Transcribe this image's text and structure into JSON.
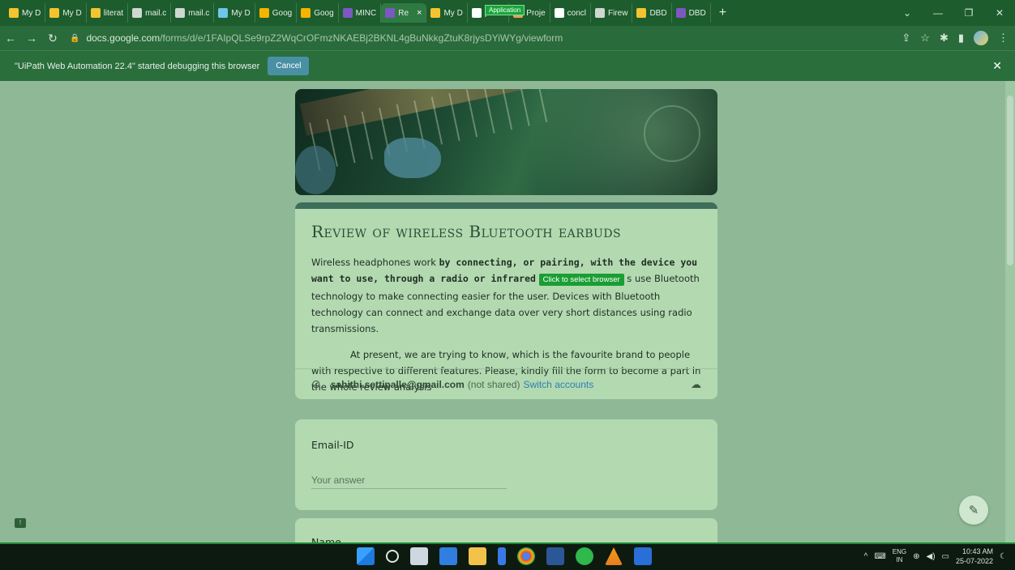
{
  "browser": {
    "tabs": [
      {
        "label": "My D",
        "icon": "drive-icon",
        "color": "#f4c430"
      },
      {
        "label": "My D",
        "icon": "drive-icon",
        "color": "#f4c430"
      },
      {
        "label": "literat",
        "icon": "drive-icon",
        "color": "#f4c430"
      },
      {
        "label": "mail.c",
        "icon": "globe-icon",
        "color": "#cfd8cf"
      },
      {
        "label": "mail.c",
        "icon": "globe-icon",
        "color": "#cfd8cf"
      },
      {
        "label": "My D",
        "icon": "loading-icon",
        "color": "#6ec6e8"
      },
      {
        "label": "Goog",
        "icon": "slides-icon",
        "color": "#f4b400"
      },
      {
        "label": "Goog",
        "icon": "slides-icon",
        "color": "#f4b400"
      },
      {
        "label": "MINC",
        "icon": "forms-icon",
        "color": "#7e57c2"
      },
      {
        "label": "Re",
        "icon": "forms-icon",
        "color": "#7e57c2",
        "active": true
      },
      {
        "label": "My D",
        "icon": "drive-icon",
        "color": "#f4c430"
      },
      {
        "label": "plann",
        "icon": "google-icon",
        "color": "#ffffff"
      },
      {
        "label": "Proje",
        "icon": "ring-icon",
        "color": "#e8a25a"
      },
      {
        "label": "concl",
        "icon": "google-icon",
        "color": "#ffffff"
      },
      {
        "label": "Firew",
        "icon": "globe-icon",
        "color": "#cfd8cf"
      },
      {
        "label": "DBD",
        "icon": "drive-icon",
        "color": "#f4c430"
      },
      {
        "label": "DBD",
        "icon": "forms-icon",
        "color": "#7e57c2"
      }
    ],
    "application_badge": "Application",
    "url_host": "docs.google.com",
    "url_path": "/forms/d/e/1FAIpQLSe9rpZ2WqCrOFmzNKAEBj2BKNL4gBuNkkgZtuK8rjysDYiWYg/viewform",
    "infobar_text": "\"UiPath Web Automation 22.4\" started debugging this browser",
    "infobar_cancel": "Cancel"
  },
  "form": {
    "title": "Review of wireless Bluetooth earbuds",
    "desc_part1": "Wireless headphones work ",
    "desc_bold": "by connecting, or pairing, with the device you want to use, through a radio or infrared",
    "tooltip": "Click to select browser",
    "desc_part2": "s use Bluetooth technology to make connecting easier for the user. Devices with Bluetooth technology can connect and exchange data over very short distances using radio transmissions.",
    "desc_para2": "At present, we are trying to know, which is the favourite brand to people with respective to different features. Please, kindly fill the form to become a part in the whole review analysis",
    "account_email": "sahithi.settipalle@gmail.com",
    "account_not_shared": "(not shared)",
    "switch_accounts": "Switch accounts",
    "questions": [
      {
        "label": "Email-ID",
        "placeholder": "Your answer"
      },
      {
        "label": "Name"
      }
    ]
  },
  "taskbar": {
    "lang_line1": "ENG",
    "lang_line2": "IN",
    "time": "10:43 AM",
    "date": "25-07-2022"
  },
  "colors": {
    "tabbar": "#1c5c2d",
    "page_bg": "#8fb996",
    "card_bg": "#b3d9b1",
    "link": "#2d7fb2",
    "tooltip": "#1a9e34"
  }
}
